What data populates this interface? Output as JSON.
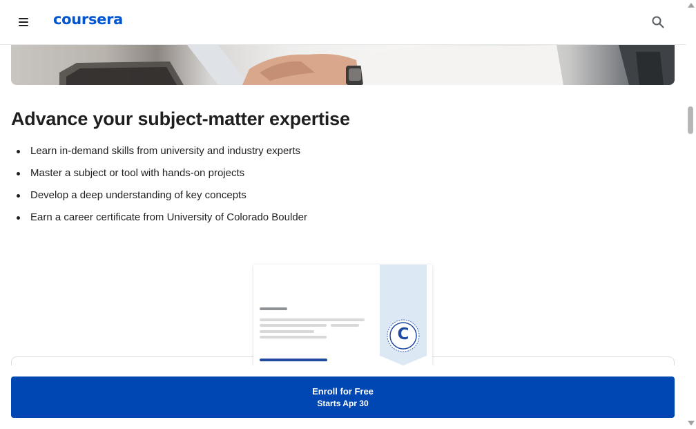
{
  "header": {
    "logo_text": "coursera",
    "menu_icon": "hamburger-menu-icon",
    "search_icon": "search-icon",
    "brand_color": "#0056d2"
  },
  "hero": {
    "image": "person-typing-on-laptop"
  },
  "section": {
    "title": "Advance your subject-matter expertise",
    "bullets": [
      "Learn in-demand skills from university and industry experts",
      "Master a subject or tool with hands-on projects",
      "Develop a deep understanding of key concepts",
      "Earn a career certificate from University of Colorado Boulder"
    ]
  },
  "certificate": {
    "badge_letter": "C",
    "ribbon_color": "#dde8f5",
    "accent_color": "#1f4aa0"
  },
  "enroll": {
    "label": "Enroll for Free",
    "sublabel": "Starts Apr 30",
    "color": "#0047b3"
  }
}
